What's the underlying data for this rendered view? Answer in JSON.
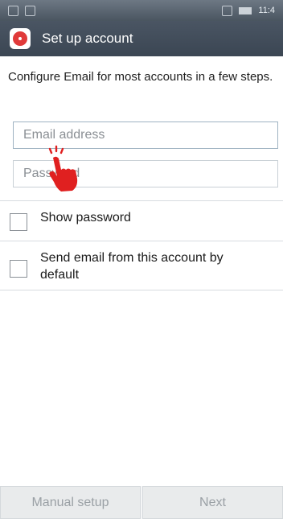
{
  "status_bar": {
    "time": "11:4"
  },
  "action_bar": {
    "title": "Set up account",
    "app_icon": "email-app-icon"
  },
  "description": "Configure Email for most accounts in a few steps.",
  "fields": {
    "email": {
      "placeholder": "Email address",
      "value": ""
    },
    "password": {
      "placeholder": "Password",
      "value": ""
    }
  },
  "checkboxes": {
    "show_password": {
      "label": "Show password",
      "checked": false
    },
    "send_default": {
      "label": "Send email from this account by default",
      "checked": false
    }
  },
  "buttons": {
    "manual_setup": "Manual setup",
    "next": "Next"
  },
  "colors": {
    "action_bar": "#3f4a57",
    "app_icon_red": "#e03a3a",
    "hand_cursor": "#e02020"
  }
}
